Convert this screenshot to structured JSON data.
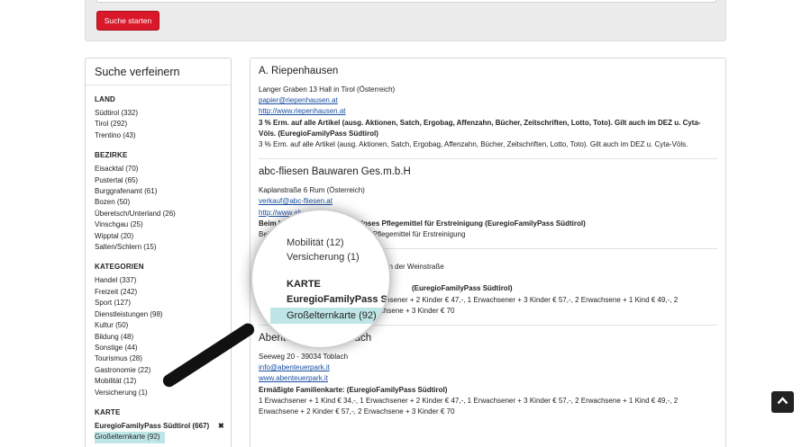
{
  "search": {
    "button_label": "Suche starten"
  },
  "sidebar": {
    "title": "Suche verfeinern",
    "land": {
      "heading": "LAND",
      "items": [
        "Südtirol (332)",
        "Tirol (292)",
        "Trentino (43)"
      ]
    },
    "bezirke": {
      "heading": "BEZIRKE",
      "items": [
        "Eisacktal (70)",
        "Pustertal (65)",
        "Burggrafenamt (61)",
        "Bozen (50)",
        "Überetsch/Unterland (26)",
        "Vinschgau (25)",
        "Wipptal (20)",
        "Salten/Schlern (15)"
      ]
    },
    "kategorien": {
      "heading": "KATEGORIEN",
      "items": [
        "Handel (337)",
        "Freizeit (242)",
        "Sport (127)",
        "Dienstleistungen (98)",
        "Kultur (50)",
        "Bildung (48)",
        "Sonstige (44)",
        "Tourismus (28)",
        "Gastronomie (22)",
        "Mobilität (12)",
        "Versicherung (1)"
      ]
    },
    "karte": {
      "heading": "KARTE",
      "selected": "EuregioFamilyPass Südtirol (667)",
      "remove": "✖",
      "highlighted": "Großelternkarte (92)"
    }
  },
  "results": [
    {
      "title": "A. Riepenhausen",
      "address": "Langer Graben 13 Hall in Tirol (Österreich)",
      "email": "papier@riepenhausen.at",
      "web": "http://www.riepenhausen.at",
      "offer_bold": "3 % Erm. auf alle Artikel (ausg. Aktionen, Satch, Ergobag, Affenzahn, Bücher, Zeitschriften, Lotto, Toto). Gilt auch im DEZ u. Cyta-Völs. (EuregioFamilyPass Südtirol)",
      "offer_text": "3 % Erm. auf alle Artikel (ausg. Aktionen, Satch, Ergobag, Affenzahn, Bücher, Zeitschriften, Lotto, Toto). Gilt auch im DEZ u. Cyta-Völs."
    },
    {
      "title": "abc-fliesen Bauwaren Ges.m.b.H",
      "address": "Kaplanstraße 6 Rum (Österreich)",
      "email": "verkauf@abc-fliesen.at",
      "web": "http://www.abc-fliesen.at",
      "offer_bold": "Beim Kauf von Fliesen kostenloses Pflegemittel für Erstreinigung (EuregioFamilyPass Südtirol)",
      "offer_text": "Beim Kauf von Fliesen kostenloses Pflegemittel für Erstreinigung"
    },
    {
      "title": "",
      "address": "an der Weinstraße",
      "email": "",
      "web": "",
      "offer_bold": "(EuregioFamilyPass Südtirol)",
      "offer_text": "1 Erwachsener + 1 Kind € 34,-, 1 Erwachsener + 2 Kinder € 47,-, 1 Erwachsener + 3 Kinder € 57,-, 2 Erwachsene + 1 Kind € 49,-, 2 Erwachsene + 2 Kinder € 57,-, 2 Erwachsene + 3 Kinder € 70"
    },
    {
      "title": "Abenteuerpark - Toblach",
      "address": "Seeweg 20 - 39034 Toblach",
      "email": "info@abenteuerpark.it",
      "web": "www.abenteuerpark.it",
      "offer_bold": "Ermäßigte Familienkarte: (EuregioFamilyPass Südtirol)",
      "offer_text": "1 Erwachsener + 1 Kind € 34,-, 1 Erwachsener + 2 Kinder € 47,-, 1 Erwachsener + 3 Kinder € 57,-, 2 Erwachsene + 1 Kind € 49,-, 2 Erwachsene + 2 Kinder € 57,-, 2 Erwachsene + 3 Kinder € 70"
    }
  ],
  "magnifier": {
    "lines": [
      "Mobilität (12)",
      "Versicherung (1)"
    ],
    "heading": "KARTE",
    "selected": "EuregioFamilyPass Sü",
    "highlighted": "Großelternkarte (92)"
  }
}
